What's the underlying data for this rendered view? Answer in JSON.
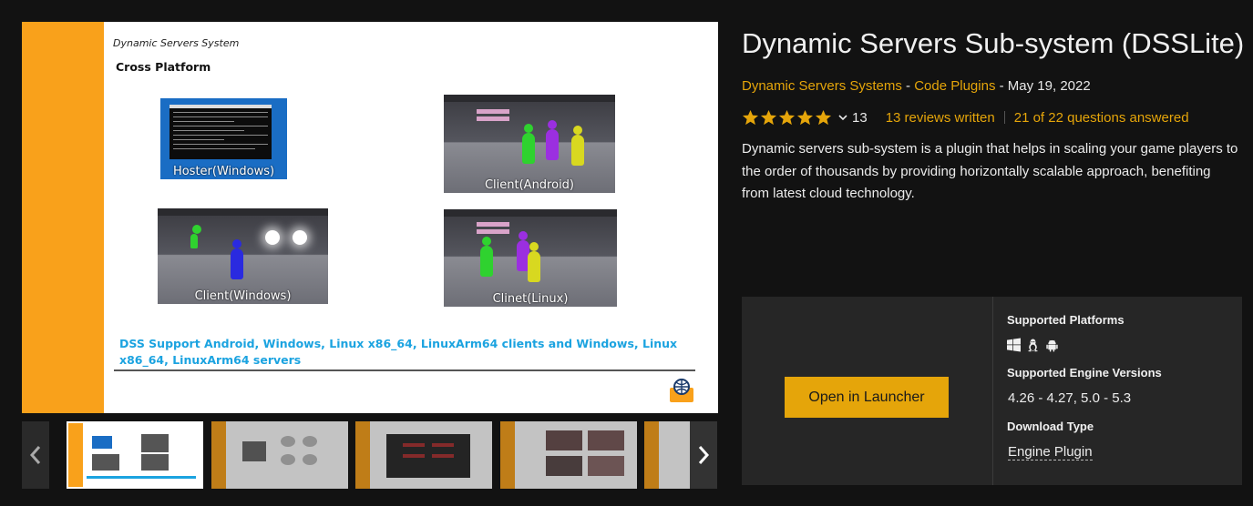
{
  "product": {
    "title": "Dynamic Servers Sub-system (DSSLite)",
    "seller": "Dynamic Servers Systems",
    "category": "Code Plugins",
    "date": "May 19, 2022",
    "meta_separator": " - ",
    "rating_stars": 5,
    "rating_count": "13",
    "reviews_link": "13 reviews written",
    "questions_link": "21 of 22 questions answered",
    "description": "Dynamic servers sub-system is a plugin that helps in scaling your game players to the order of thousands by providing horizontally scalable approach, benefiting from latest cloud technology."
  },
  "gallery": {
    "slide": {
      "subtitle": "Dynamic Servers System",
      "heading": "Cross Platform",
      "captions": {
        "hoster": "Hoster(Windows)",
        "android": "Client(Android)",
        "windows": "Client(Windows)",
        "linux": "Clinet(Linux)"
      },
      "footer_text": "DSS Support Android, Windows, Linux x86_64, LinuxArm64 clients and Windows, Linux x86_64, LinuxArm64 servers"
    },
    "thumbnail_count": 5,
    "active_thumbnail": 1
  },
  "card": {
    "button_label": "Open in Launcher",
    "platforms_label": "Supported Platforms",
    "platforms": [
      "windows-icon",
      "linux-icon",
      "android-icon"
    ],
    "engine_label": "Supported Engine Versions",
    "engine_versions": "4.26 - 4.27, 5.0 - 5.3",
    "download_label": "Download Type",
    "download_type": "Engine Plugin"
  },
  "colors": {
    "accent": "#e5a50a",
    "background": "#121212",
    "card": "#262626",
    "slide_bar": "#f9a11b",
    "slide_text_blue": "#1ba3e0"
  }
}
